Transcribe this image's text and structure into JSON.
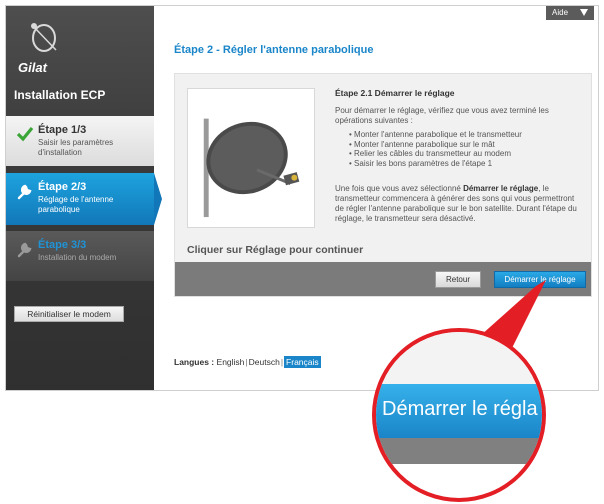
{
  "brand": {
    "logo_text": "Gilat"
  },
  "app": {
    "title": "Installation ECP"
  },
  "help": {
    "label": "Aide"
  },
  "steps": [
    {
      "title": "Étape 1/3",
      "subtitle": "Saisir les paramètres d'installation",
      "state": "done",
      "icon": "check-icon"
    },
    {
      "title": "Étape 2/3",
      "subtitle": "Réglage de l'antenne parabolique",
      "state": "active",
      "icon": "wrench-icon"
    },
    {
      "title": "Étape 3/3",
      "subtitle": "Installation du modem",
      "state": "pending",
      "icon": "wrench-icon"
    }
  ],
  "sidebar": {
    "reset_label": "Réinitialiser le modem"
  },
  "main": {
    "page_title": "Étape 2 - Régler l'antenne parabolique",
    "substep_title": "Étape 2.1 Démarrer le réglage",
    "intro": "Pour démarrer le réglage, vérifiez que vous avez terminé les opérations suivantes :",
    "bullets": [
      "Monter l'antenne parabolique et le transmetteur",
      "Monter l'antenne parabolique sur le mât",
      "Relier les câbles du transmetteur au modem",
      "Saisir les bons paramètres de l'étape 1"
    ],
    "detail_before": "Une fois que vous avez sélectionné ",
    "detail_bold": "Démarrer le réglage",
    "detail_after": ", le transmetteur commencera à générer des sons qui vous permettront de régler l'antenne parabolique sur le bon satellite. Durant l'étape du réglage, le transmetteur sera désactivé.",
    "continue_text": "Cliquer sur Réglage pour continuer",
    "back_label": "Retour",
    "start_label": "Démarrer le réglage"
  },
  "languages": {
    "label": "Langues :",
    "options": [
      "English",
      "Deutsch",
      "Français"
    ],
    "selected": "Français"
  },
  "zoom": {
    "text": "Démarrer le régla"
  },
  "colors": {
    "accent": "#1a86c9",
    "highlight": "#e31e24",
    "sidebar": "#3a3a3a"
  }
}
